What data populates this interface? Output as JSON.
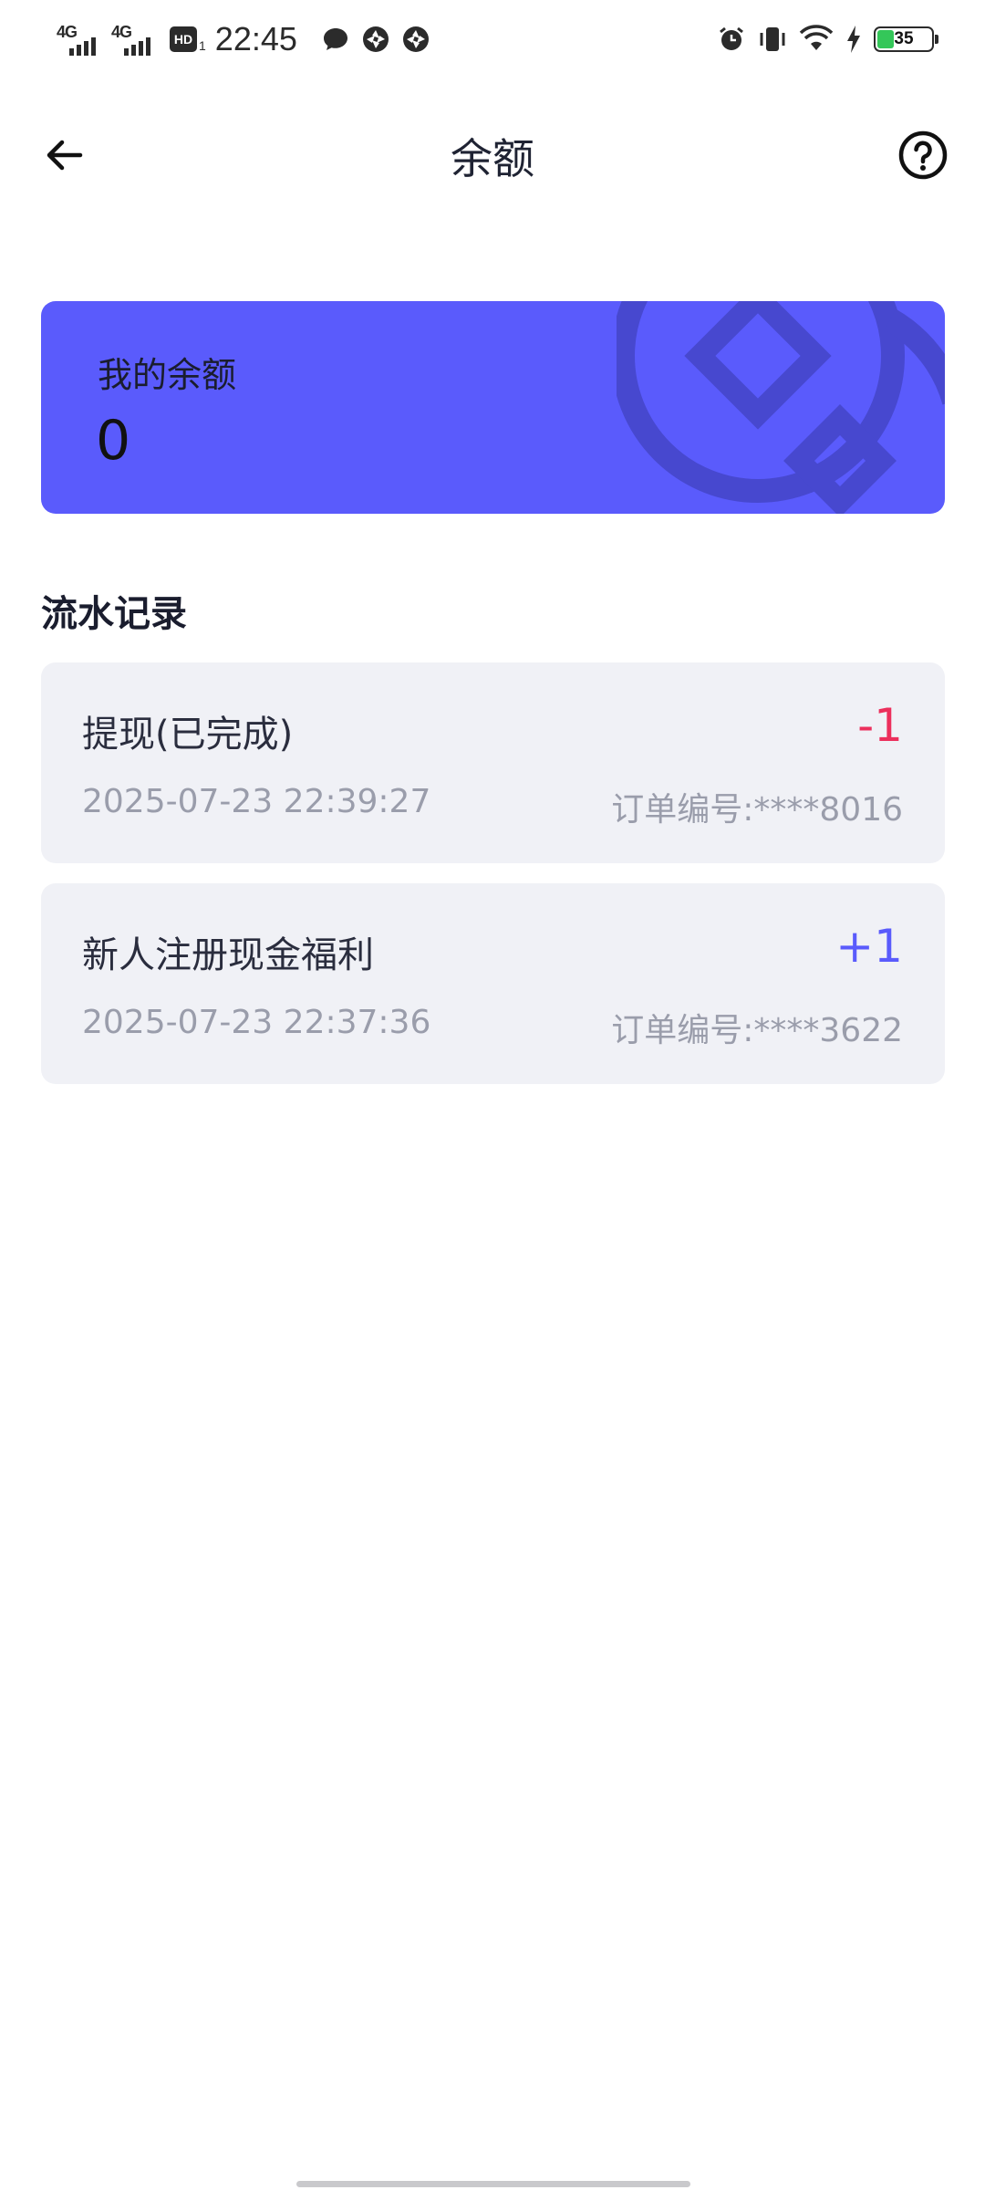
{
  "status_bar": {
    "signal1_label": "4G",
    "signal2_label": "4G",
    "hd_label": "HD",
    "hd_sub": "1",
    "time": "22:45",
    "battery_level": "35",
    "battery_color": "#34c759",
    "icons": [
      "chat-bubble-icon",
      "aperture-icon",
      "aperture-icon",
      "alarm-icon",
      "vibrate-icon",
      "wifi-icon",
      "charging-icon",
      "battery-icon"
    ]
  },
  "header": {
    "title": "余额",
    "back_icon": "arrow-left-icon",
    "help_icon": "question-circle-icon"
  },
  "balance_card": {
    "label": "我的余额",
    "value": "0",
    "background": "#5a5bfc"
  },
  "records_section": {
    "title": "流水记录",
    "items": [
      {
        "title": "提现(已完成)",
        "amount": "-1",
        "amount_color": "#ec2f5c",
        "time": "2025-07-23  22:39:27",
        "order": "订单编号:****8016"
      },
      {
        "title": "新人注册现金福利",
        "amount": "+1",
        "amount_color": "#5a5bfc",
        "time": "2025-07-23  22:37:36",
        "order": "订单编号:****3622"
      }
    ]
  }
}
